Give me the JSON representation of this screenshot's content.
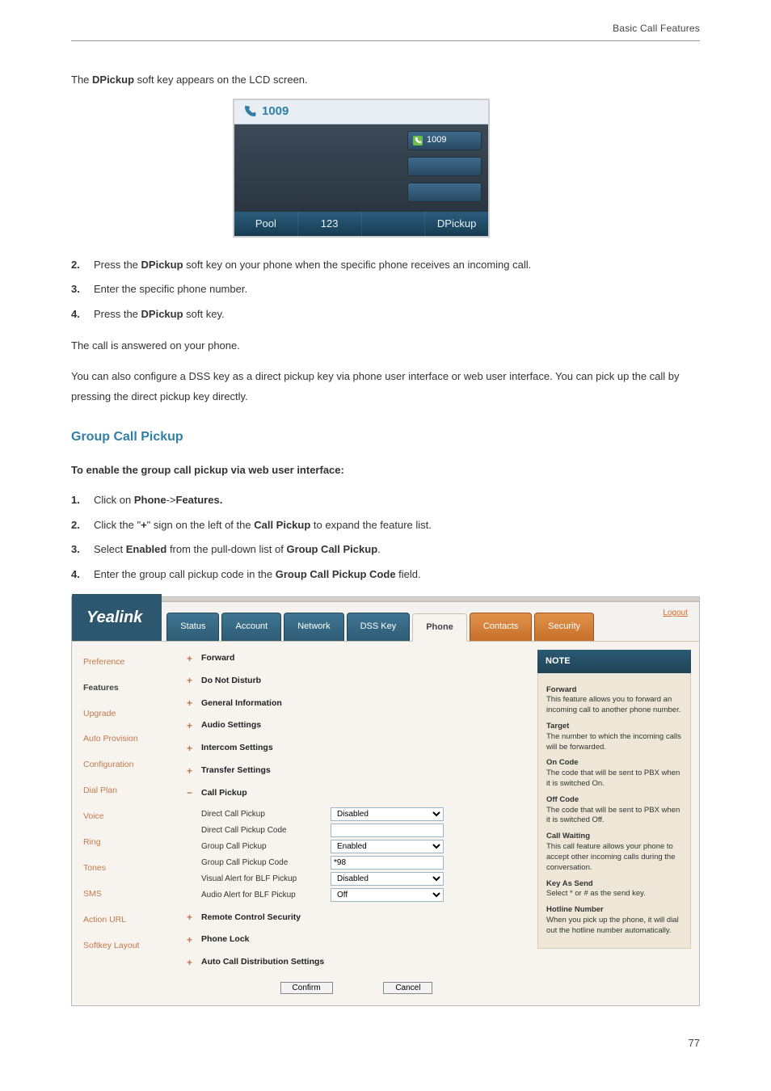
{
  "header": {
    "section": "Basic Call Features"
  },
  "intro": {
    "line1_pre": "The ",
    "line1_b": "DPickup",
    "line1_post": " soft key appears on the LCD screen."
  },
  "lcd": {
    "ext": "1009",
    "slot1": "1009",
    "softkeys": [
      "Pool",
      "123",
      "",
      "DPickup"
    ]
  },
  "steps_a": [
    {
      "n": "2.",
      "pre": "Press the ",
      "b": "DPickup",
      "post": " soft key on your phone when the specific phone receives an incoming call."
    },
    {
      "n": "3.",
      "pre": "Enter the specific phone number.",
      "b": "",
      "post": ""
    },
    {
      "n": "4.",
      "pre": "Press the ",
      "b": "DPickup",
      "post": " soft key."
    }
  ],
  "after4": "The call is answered on your phone.",
  "para2": "You can also configure a DSS key as a direct pickup key via phone user interface or web user interface. You can pick up the call by pressing the direct pickup key directly.",
  "group": {
    "title": "Group Call Pickup",
    "lead": "To enable the group call pickup via web user interface:",
    "s1_a": "Click on ",
    "s1_b": "Phone",
    "s1_c": "->",
    "s1_d": "Features.",
    "s2_a": "Click the \"",
    "s2_b": "+",
    "s2_c": "\" sign on the left of the ",
    "s2_d": "Call Pickup",
    "s2_e": " to expand the feature list.",
    "s3_a": "Select ",
    "s3_b": "Enabled",
    "s3_c": " from the pull-down list of ",
    "s3_d": "Group Call Pickup",
    "s3_e": ".",
    "s4_a": "Enter the group call pickup code in the ",
    "s4_b": "Group Call Pickup Code",
    "s4_c": " field."
  },
  "webui": {
    "brand": "Yealink",
    "logout": "Logout",
    "tabs": [
      "Status",
      "Account",
      "Network",
      "DSS Key",
      "Phone",
      "Contacts",
      "Security"
    ],
    "side": [
      "Preference",
      "Features",
      "Upgrade",
      "Auto Provision",
      "Configuration",
      "Dial Plan",
      "Voice",
      "Ring",
      "Tones",
      "SMS",
      "Action URL",
      "Softkey Layout"
    ],
    "acc": [
      "Forward",
      "Do Not Disturb",
      "General Information",
      "Audio Settings",
      "Intercom Settings",
      "Transfer Settings",
      "Call Pickup",
      "Remote Control Security",
      "Phone Lock",
      "Auto Call Distribution Settings"
    ],
    "callpickup": {
      "rows": [
        {
          "label": "Direct Call Pickup",
          "type": "select",
          "value": "Disabled"
        },
        {
          "label": "Direct Call Pickup Code",
          "type": "text",
          "value": ""
        },
        {
          "label": "Group Call Pickup",
          "type": "select",
          "value": "Enabled"
        },
        {
          "label": "Group Call Pickup Code",
          "type": "text",
          "value": "*98"
        },
        {
          "label": "Visual Alert for BLF Pickup",
          "type": "select",
          "value": "Disabled"
        },
        {
          "label": "Audio Alert for BLF Pickup",
          "type": "select",
          "value": "Off"
        }
      ]
    },
    "buttons": {
      "confirm": "Confirm",
      "cancel": "Cancel"
    },
    "note": {
      "title": "NOTE",
      "items": [
        {
          "t": "Forward",
          "d": "This feature allows you to forward an incoming call to another phone number."
        },
        {
          "t": "Target",
          "d": "The number to which the incoming calls will be forwarded."
        },
        {
          "t": "On Code",
          "d": "The code that will be sent to PBX when it is switched On."
        },
        {
          "t": "Off Code",
          "d": "The code that will be sent to PBX when it is switched Off."
        },
        {
          "t": "Call Waiting",
          "d": "This call feature allows your phone to accept other incoming calls during the conversation."
        },
        {
          "t": "Key As Send",
          "d": "Select * or # as the send key."
        },
        {
          "t": "Hotline Number",
          "d": "When you pick up the phone, it will dial out the hotline number automatically."
        }
      ]
    }
  },
  "pagenum": "77"
}
